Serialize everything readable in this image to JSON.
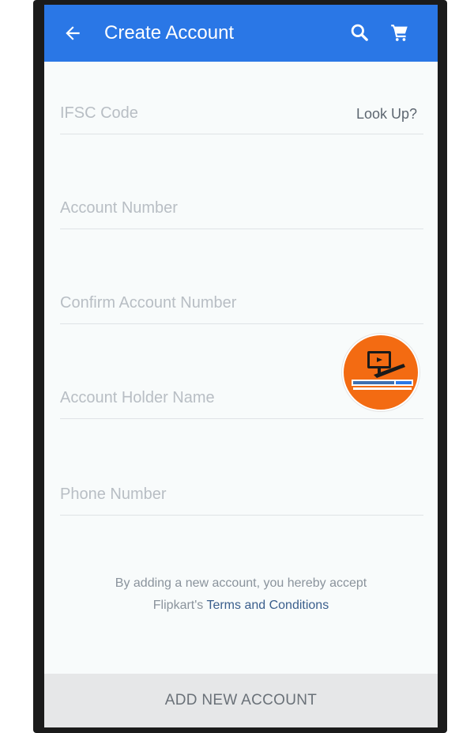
{
  "appbar": {
    "title": "Create Account",
    "back_icon": "arrow-left-icon",
    "search_icon": "search-icon",
    "cart_icon": "cart-icon",
    "color": "#2a77e6"
  },
  "form": {
    "ifsc": {
      "placeholder": "IFSC Code",
      "value": "",
      "action": "Look Up?"
    },
    "account_number": {
      "placeholder": "Account Number",
      "value": ""
    },
    "confirm_account_number": {
      "placeholder": "Confirm Account Number",
      "value": ""
    },
    "account_holder_name": {
      "placeholder": "Account Holder Name",
      "value": ""
    },
    "phone_number": {
      "placeholder": "Phone Number",
      "value": ""
    }
  },
  "terms": {
    "line1": "By adding a new account, you hereby accept",
    "prefix": "Flipkart's ",
    "link": "Terms and Conditions"
  },
  "submit": {
    "label": "ADD NEW ACCOUNT"
  },
  "overlay": {
    "icon": "channel-logo-badge",
    "color": "#f36b12"
  }
}
